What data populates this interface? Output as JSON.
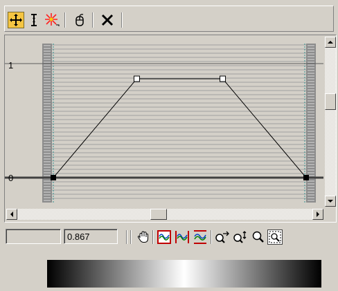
{
  "toolbar": {
    "buttons": [
      {
        "name": "move-points-icon",
        "active": true
      },
      {
        "name": "scale-point-icon",
        "active": false
      },
      {
        "name": "add-point-icon",
        "active": false
      },
      {
        "name": "reset-curve-icon",
        "active": false
      },
      {
        "name": "delete-point-icon",
        "active": false
      }
    ]
  },
  "graph": {
    "y_label_top": "1",
    "y_label_bottom": "0",
    "curve_points": [
      {
        "x": 0.0,
        "y": 0.0,
        "type": "corner"
      },
      {
        "x": 0.33,
        "y": 1.0,
        "type": "bezier"
      },
      {
        "x": 0.67,
        "y": 1.0,
        "type": "bezier"
      },
      {
        "x": 1.0,
        "y": 0.0,
        "type": "corner"
      }
    ],
    "colors": {
      "grid_line": "#a0a0a0",
      "curve": "#000000",
      "baseline": "#404040",
      "teal_marker": "#2f8f8f"
    }
  },
  "statusbar": {
    "position_value": "",
    "value_field": "0.867",
    "tools": [
      "pan-hand-icon",
      "zoom-extents-icon",
      "zoom-horizontal-extents-icon",
      "zoom-value-extents-icon",
      "zoom-horizontal-icon",
      "zoom-vertical-icon",
      "zoom-icon",
      "zoom-region-icon"
    ]
  },
  "gradient": {
    "colors": [
      "#000000",
      "#ffffff",
      "#000000"
    ]
  }
}
